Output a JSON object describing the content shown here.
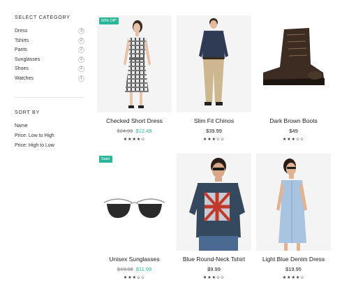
{
  "sidebar": {
    "category_title": "SELECT CATEGORY",
    "categories": [
      {
        "label": "Dress",
        "count": "3"
      },
      {
        "label": "Tshirts",
        "count": "2"
      },
      {
        "label": "Pants",
        "count": "2"
      },
      {
        "label": "Sunglasses",
        "count": "2"
      },
      {
        "label": "Shoes",
        "count": "2"
      },
      {
        "label": "Watches",
        "count": "1"
      }
    ],
    "sort_title": "SORT BY",
    "sort_options": [
      "Name",
      "Price: Low to High",
      "Price: High to Low"
    ]
  },
  "products": [
    {
      "name": "Checked Short Dress",
      "old_price": "$24.99",
      "price": "$12.49",
      "badge": "50% Off*",
      "stars": "★★★★✩"
    },
    {
      "name": "Slim Fit Chinos",
      "old_price": "",
      "price": "$39.99",
      "badge": "",
      "stars": "★★★✩✩"
    },
    {
      "name": "Dark Brown Boots",
      "old_price": "",
      "price": "$49",
      "badge": "",
      "stars": "★★★✩✩"
    },
    {
      "name": "Unisex Sunglasses",
      "old_price": "$19.99",
      "price": "$11.99",
      "badge": "Sale!",
      "stars": "★★★✩✩"
    },
    {
      "name": "Blue Round-Neck Tshirt",
      "old_price": "",
      "price": "$9.99",
      "badge": "",
      "stars": "★★★✩✩"
    },
    {
      "name": "Light Blue Denim Dress",
      "old_price": "",
      "price": "$19.95",
      "badge": "",
      "stars": "★★★★✩"
    }
  ],
  "colors": {
    "accent": "#2bb59a"
  }
}
